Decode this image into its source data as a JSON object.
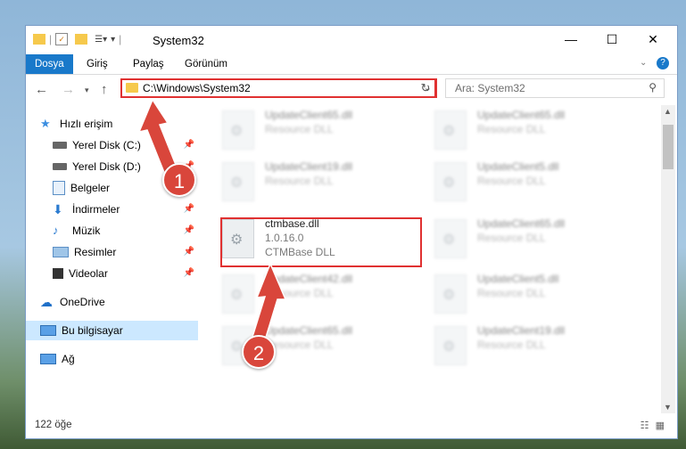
{
  "window": {
    "title": "System32",
    "minimize_icon": "minimize-icon",
    "maximize_icon": "maximize-icon",
    "close_icon": "close-icon"
  },
  "ribbon": {
    "tabs": [
      "Dosya",
      "Giriş",
      "Paylaş",
      "Görünüm"
    ],
    "active_tab": "Dosya"
  },
  "nav": {
    "address_path": "C:\\Windows\\System32",
    "search_placeholder": "Ara: System32"
  },
  "sidebar": {
    "items": [
      {
        "label": "Hızlı erişim",
        "icon": "star-icon"
      },
      {
        "label": "Yerel Disk (C:)",
        "icon": "drive-icon",
        "pinned": true
      },
      {
        "label": "Yerel Disk (D:)",
        "icon": "drive-icon",
        "pinned": true
      },
      {
        "label": "Belgeler",
        "icon": "documents-icon",
        "pinned": true
      },
      {
        "label": "İndirmeler",
        "icon": "downloads-icon",
        "pinned": true
      },
      {
        "label": "Müzik",
        "icon": "music-icon",
        "pinned": true
      },
      {
        "label": "Resimler",
        "icon": "pictures-icon",
        "pinned": true
      },
      {
        "label": "Videolar",
        "icon": "videos-icon",
        "pinned": true
      },
      {
        "label": "OneDrive",
        "icon": "cloud-icon"
      },
      {
        "label": "Bu bilgisayar",
        "icon": "computer-icon",
        "selected": true
      },
      {
        "label": "Ağ",
        "icon": "network-icon"
      }
    ]
  },
  "files": [
    {
      "name": "UpdateClient65.dll",
      "type": "Resource DLL"
    },
    {
      "name": "UpdateClient65.dll",
      "type": "Resource DLL"
    },
    {
      "name": "UpdateClient19.dll",
      "type": "Resource DLL"
    },
    {
      "name": "UpdateClient5.dll",
      "type": "Resource DLL"
    },
    {
      "name": "ctmbase.dll",
      "version": "1.0.16.0",
      "type": "CTMBase DLL",
      "highlighted": true
    },
    {
      "name": "UpdateClient65.dll",
      "type": "Resource DLL"
    },
    {
      "name": "UpdateClient42.dll",
      "type": "Resource DLL"
    },
    {
      "name": "UpdateClient5.dll",
      "type": "Resource DLL"
    },
    {
      "name": "UpdateClient65.dll",
      "type": "Resource DLL"
    },
    {
      "name": "UpdateClient19.dll",
      "type": "Resource DLL"
    }
  ],
  "status": {
    "item_count": "122 öğe"
  },
  "annotations": [
    {
      "number": "1"
    },
    {
      "number": "2"
    }
  ],
  "colors": {
    "accent": "#1979ca",
    "highlight": "#e03131",
    "badge": "#d9463b"
  }
}
